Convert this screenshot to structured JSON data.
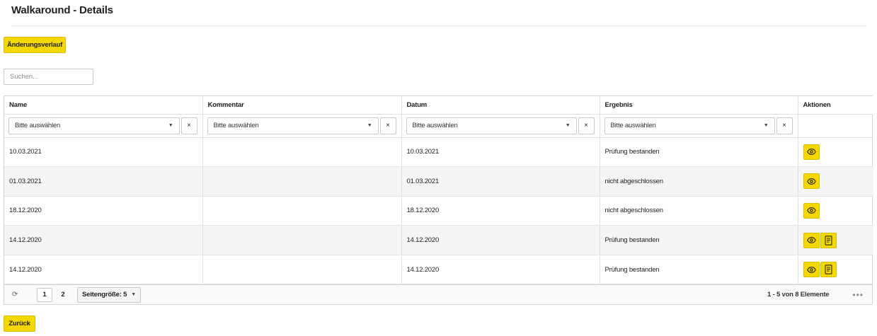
{
  "page": {
    "title": "Walkaround - Details"
  },
  "toolbar": {
    "history_label": "Änderungsverlauf"
  },
  "search": {
    "placeholder": "Suchen..."
  },
  "table": {
    "columns": [
      "Name",
      "Kommentar",
      "Datum",
      "Ergebnis",
      "Aktionen"
    ],
    "filter_placeholder": "Bitte auswählen",
    "filter_clear_symbol": "×",
    "rows": [
      {
        "name": "10.03.2021",
        "comment": "",
        "date": "10.03.2021",
        "result": "Prüfung bestanden",
        "actions": [
          "view-icon"
        ]
      },
      {
        "name": "01.03.2021",
        "comment": "",
        "date": "01.03.2021",
        "result": "nicht abgeschlossen",
        "actions": [
          "view-icon"
        ]
      },
      {
        "name": "18.12.2020",
        "comment": "",
        "date": "18.12.2020",
        "result": "nicht abgeschlossen",
        "actions": [
          "view-icon"
        ]
      },
      {
        "name": "14.12.2020",
        "comment": "",
        "date": "14.12.2020",
        "result": "Prüfung bestanden",
        "actions": [
          "view-icon",
          "report-icon"
        ]
      },
      {
        "name": "14.12.2020",
        "comment": "",
        "date": "14.12.2020",
        "result": "Prüfung bestanden",
        "actions": [
          "view-icon",
          "report-icon"
        ]
      }
    ]
  },
  "pager": {
    "pages": [
      "1",
      "2"
    ],
    "current_page": "1",
    "page_size_label": "Seitengröße: 5",
    "info": "1 - 5 von 8 Elemente",
    "refresh_icon": "refresh-icon",
    "more_icon": "more-horizontal-icon"
  },
  "footer": {
    "back_label": "Zurück"
  },
  "colors": {
    "accent": "#f5d800",
    "accent_border": "#d9bf00",
    "border": "#d6d6d6",
    "row_alt": "#f5f5f5"
  }
}
